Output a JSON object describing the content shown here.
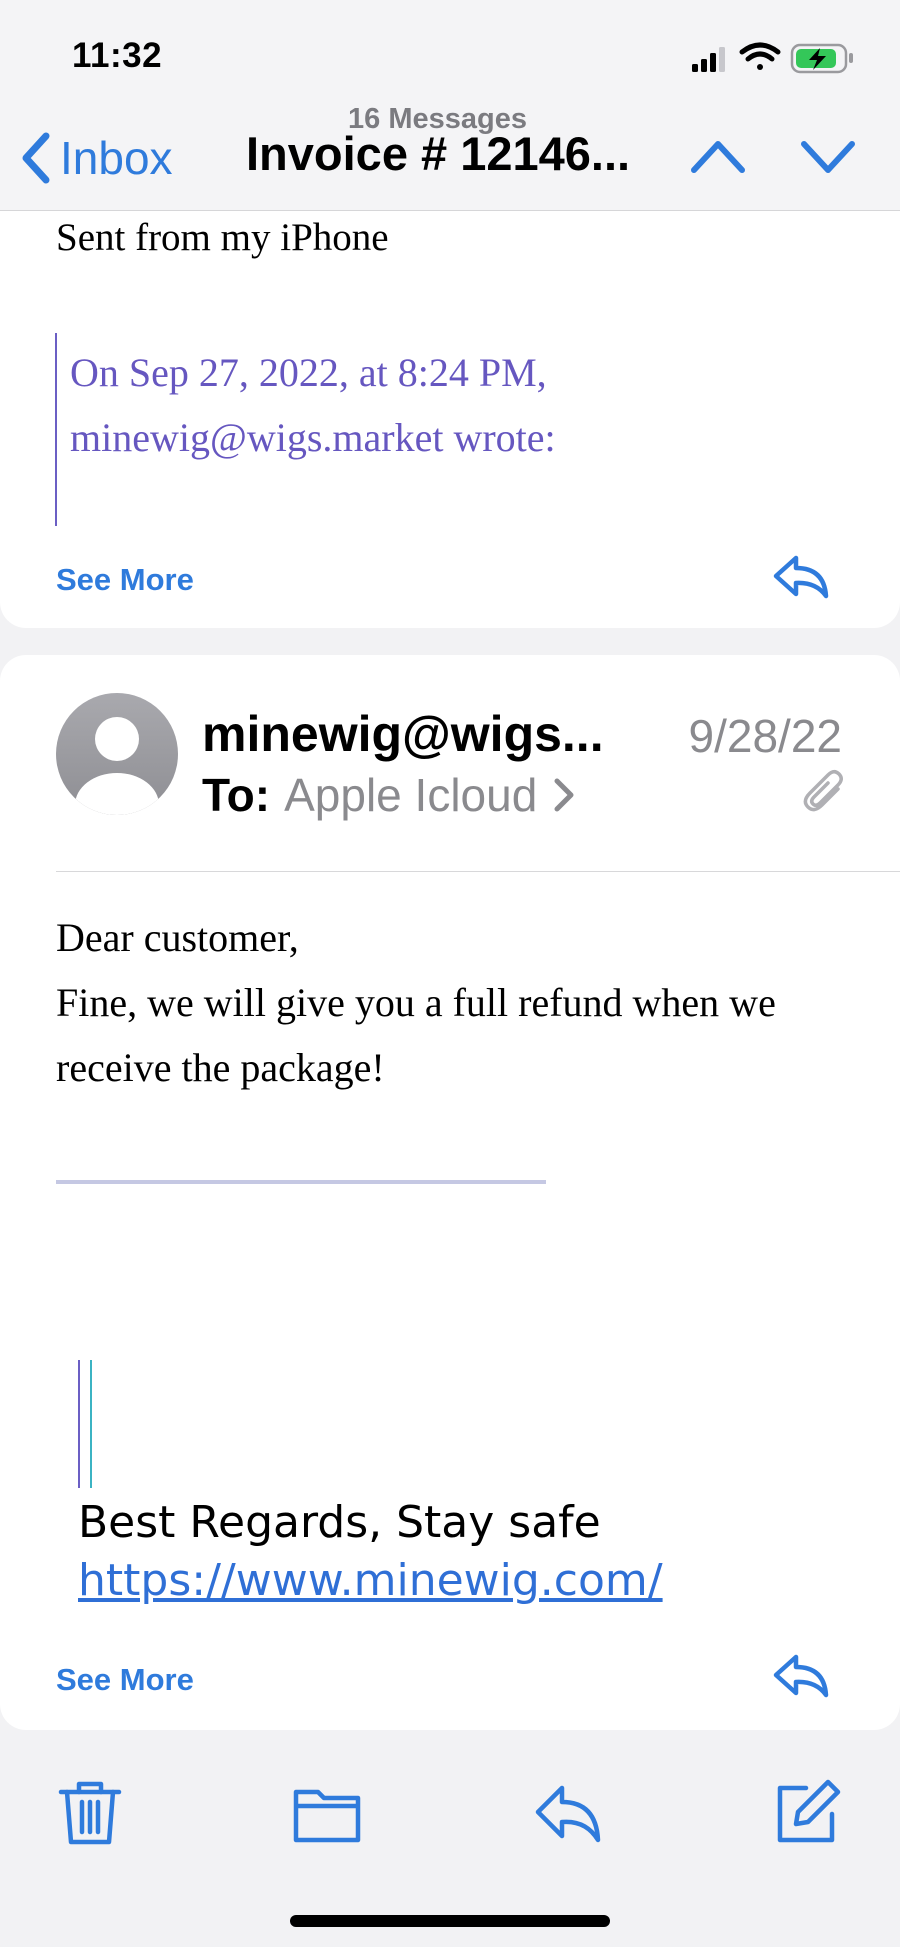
{
  "status_bar": {
    "time": "11:32",
    "battery_state": "charging"
  },
  "nav": {
    "back_label": "Inbox",
    "message_count": "16 Messages",
    "title": "Invoice # 12146..."
  },
  "previous_message": {
    "sent_from": "Sent from my iPhone",
    "quote_line1": "On Sep 27, 2022, at 8:24 PM,",
    "quote_line2": "minewig@wigs.market wrote:",
    "see_more": "See More"
  },
  "message": {
    "sender": "minewig@wigs...",
    "date": "9/28/22",
    "to_label": "To:",
    "to_name": "Apple Icloud",
    "body_line1": "Dear customer,",
    "body_line2": "Fine, we will give you a full refund when we",
    "body_line3": "receive the package!",
    "signature_regards": "Best Regards, Stay safe",
    "signature_link": "https://www.minewig.com/",
    "see_more": "See More"
  },
  "colors": {
    "accent": "#2f7bdc",
    "quote_text": "#6657c0",
    "secondary_text": "#8a8a8e"
  }
}
